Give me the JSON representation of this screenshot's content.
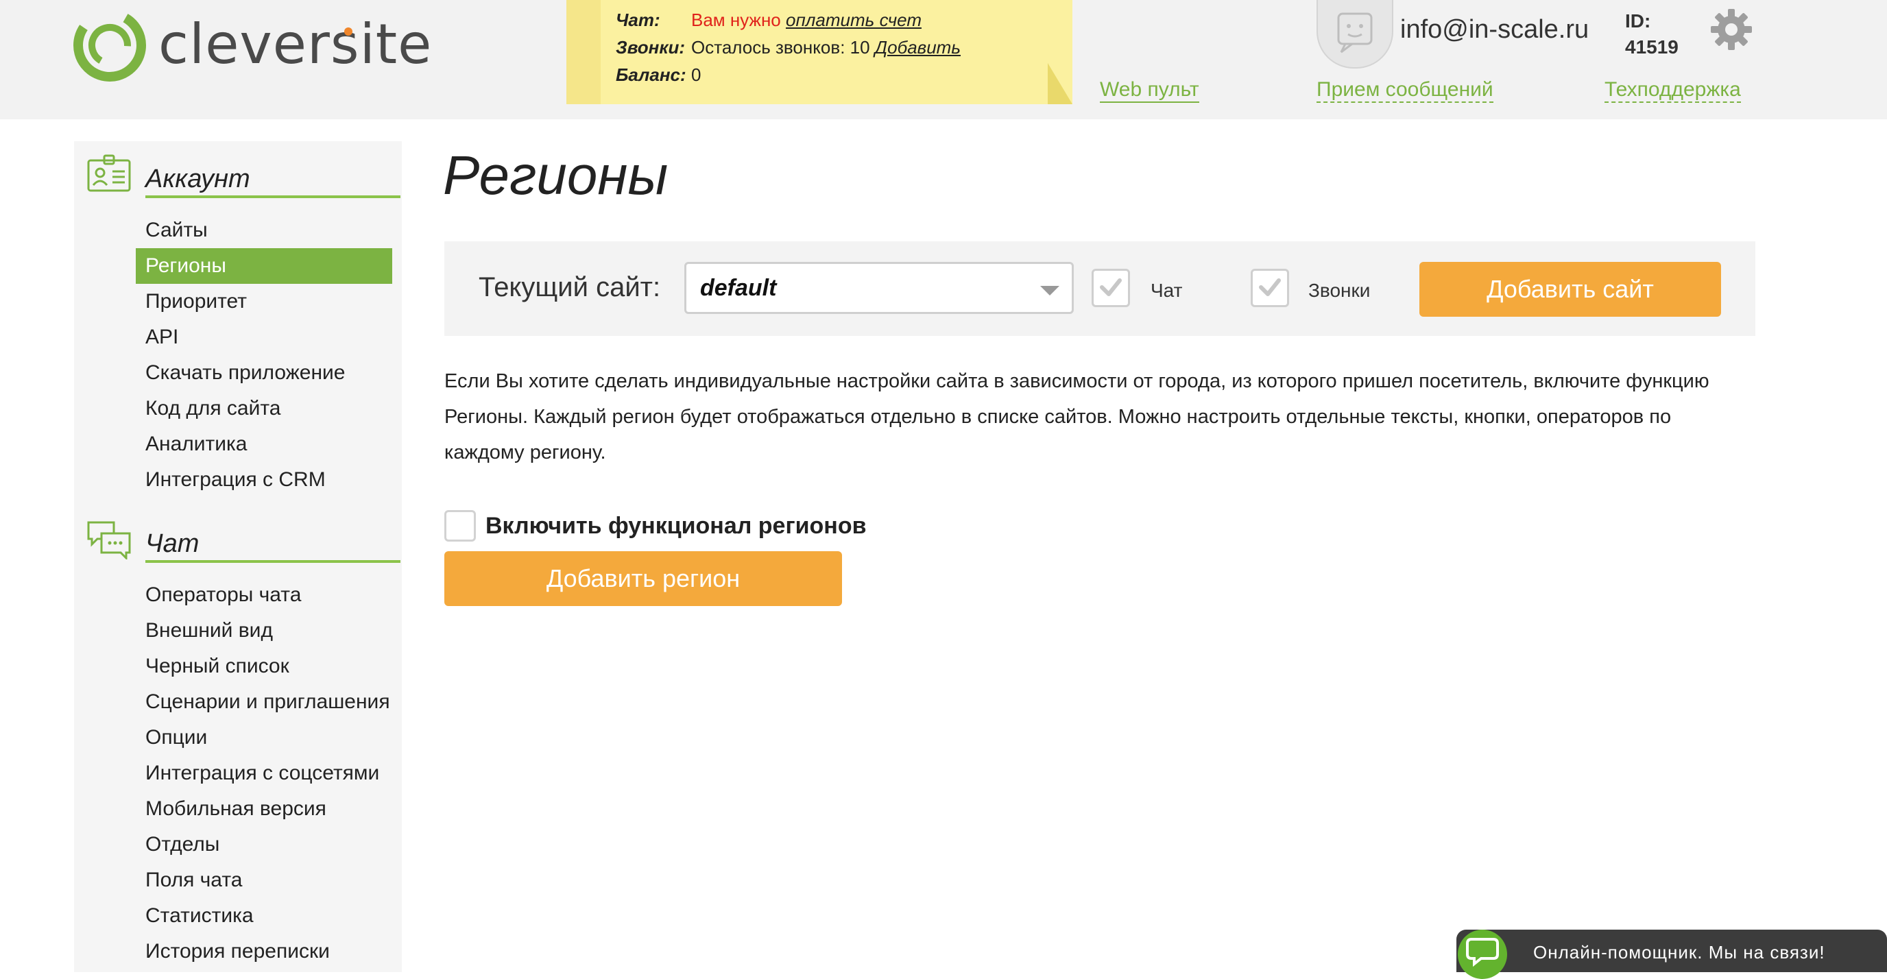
{
  "header": {
    "logo_text": "cleversite",
    "notice": {
      "chat_label": "Чат:",
      "chat_warning": "Вам нужно ",
      "chat_link": "оплатить счет",
      "calls_label": "Звонки:",
      "calls_text": "Осталось звонков: 10 ",
      "calls_link": "Добавить",
      "balance_label": "Баланс:",
      "balance_value": "0"
    },
    "email": "info@in-scale.ru",
    "id_label": "ID:",
    "id_value": "41519",
    "links": {
      "web_console": "Web пульт",
      "messages": "Прием сообщений",
      "support": "Техподдержка"
    }
  },
  "sidebar": {
    "account_title": "Аккаунт",
    "account_items": [
      "Сайты",
      "Регионы",
      "Приоритет",
      "API",
      "Скачать приложение",
      "Код для сайта",
      "Аналитика",
      "Интеграция с CRM"
    ],
    "chat_title": "Чат",
    "chat_items": [
      "Операторы чата",
      "Внешний вид",
      "Черный список",
      "Сценарии и приглашения",
      "Опции",
      "Интеграция с соцсетями",
      "Мобильная версия",
      "Отделы",
      "Поля чата",
      "Статистика",
      "История переписки"
    ]
  },
  "main": {
    "title": "Регионы",
    "current_site_label": "Текущий сайт:",
    "current_site_value": "default",
    "chat_checkbox_label": "Чат",
    "calls_checkbox_label": "Звонки",
    "add_site_button": "Добавить сайт",
    "description": "Если Вы хотите сделать индивидуальные настройки сайта в зависимости от города, из которого пришел посетитель, включите функцию Регионы. Каждый регион будет отображаться отдельно в списке сайтов. Можно настроить отдельные тексты, кнопки, операторов по каждому региону.",
    "enable_regions_label": "Включить функционал регионов",
    "add_region_button": "Добавить регион"
  },
  "chat_widget": {
    "text": "Онлайн-помощник. Мы на связи!"
  },
  "colors": {
    "brand_green": "#7cb342",
    "button_orange": "#f4a93c",
    "warning_red": "#e0231b",
    "notice_yellow": "#fbf1a0"
  }
}
